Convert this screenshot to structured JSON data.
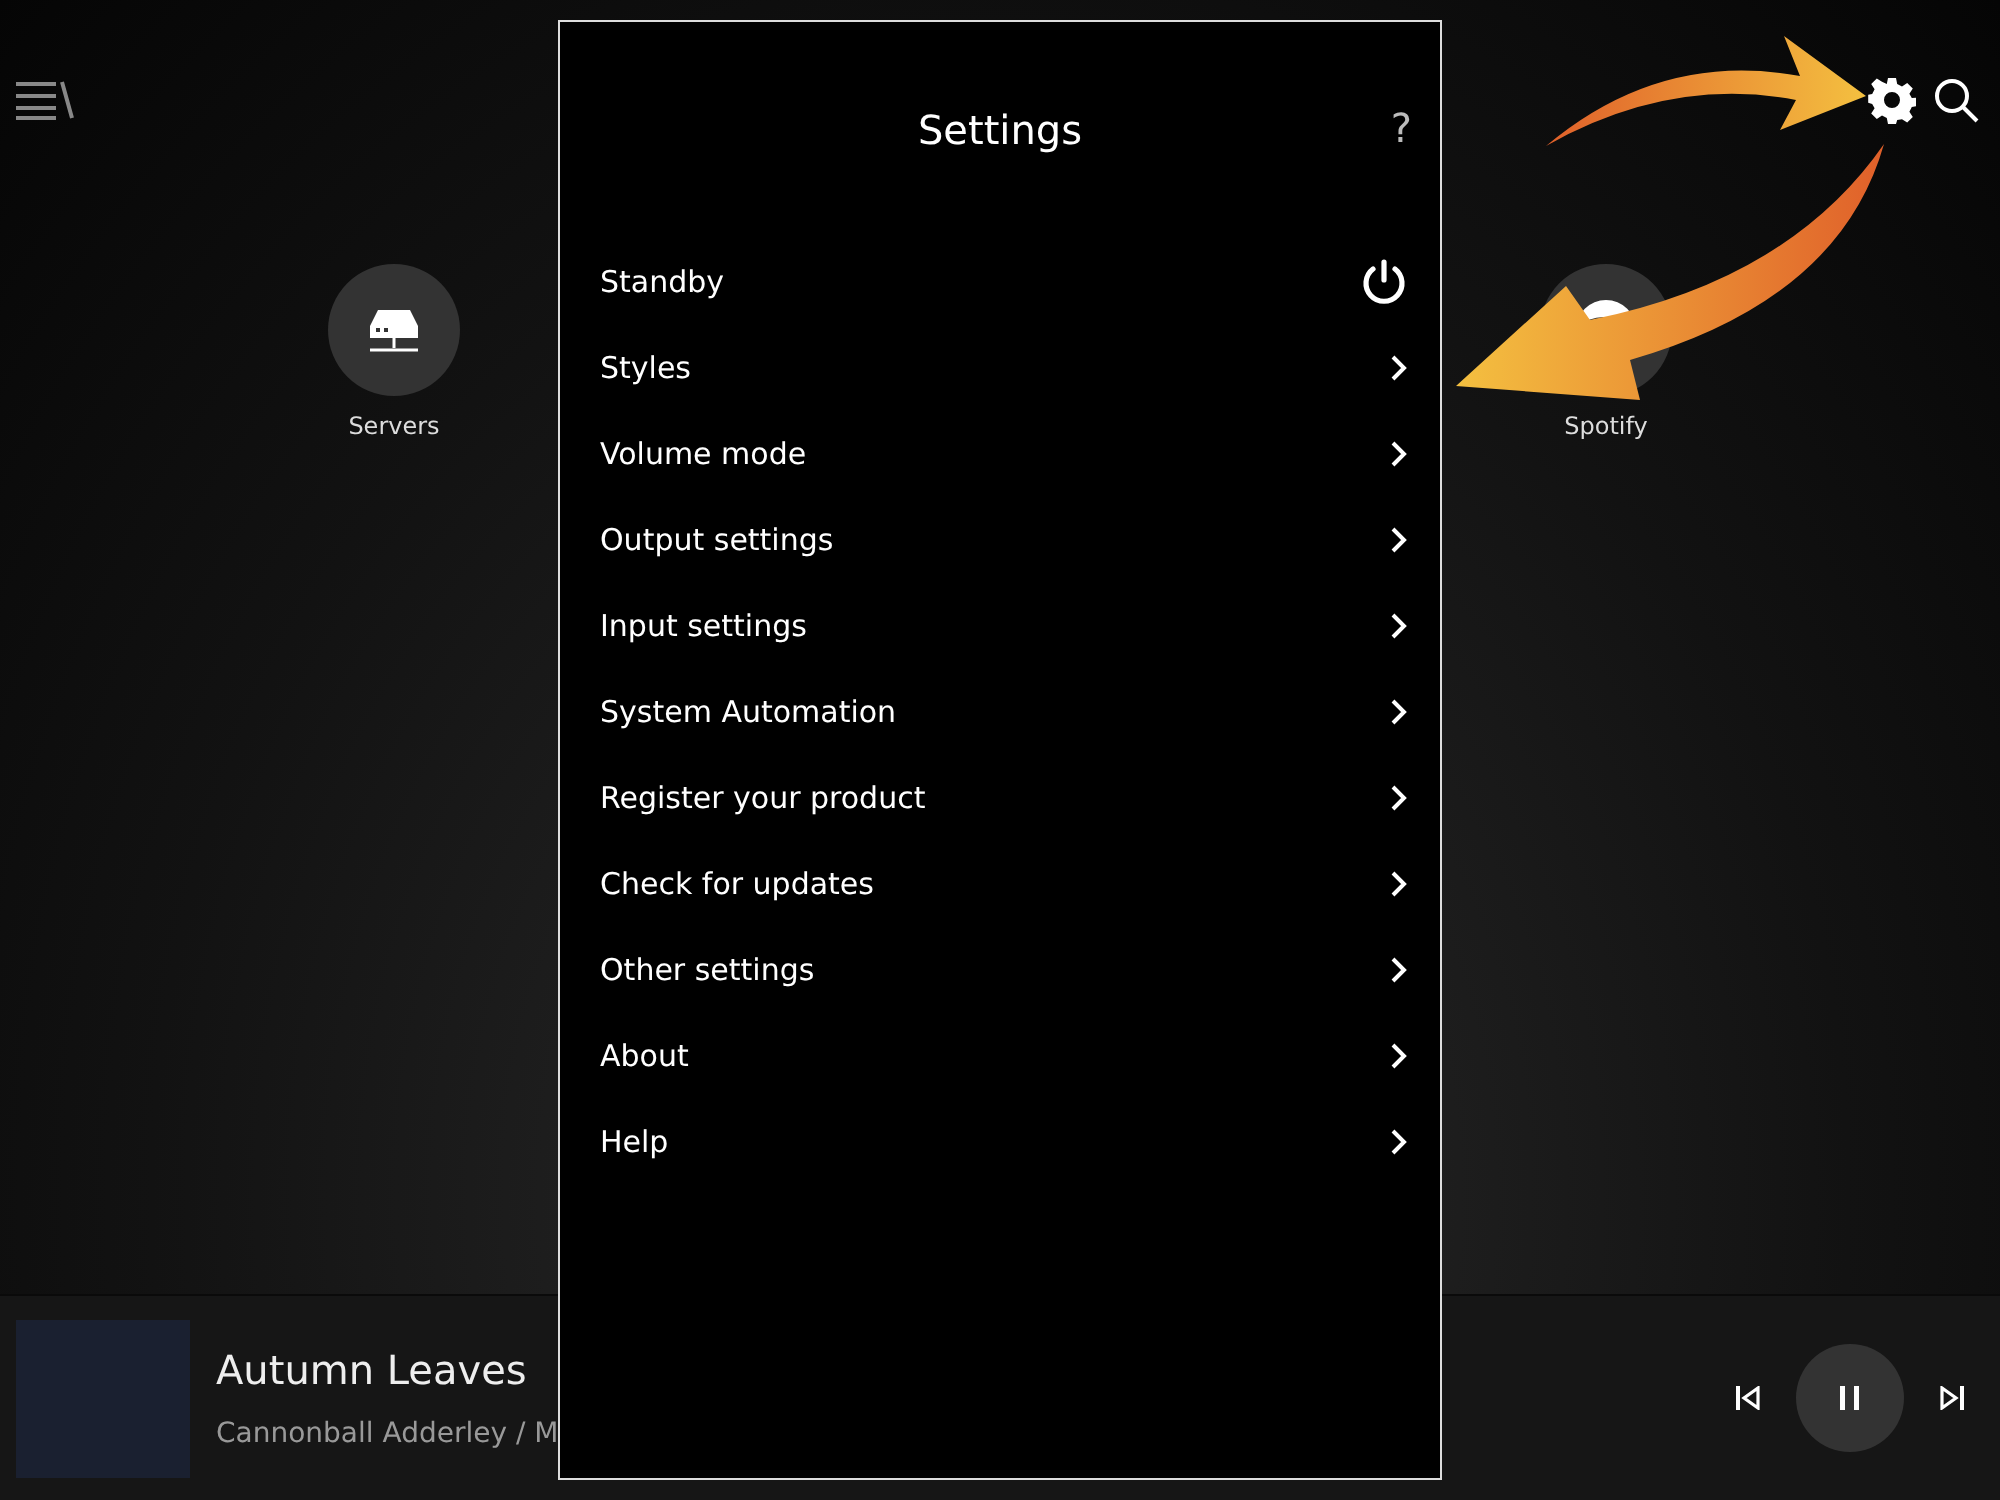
{
  "sources": [
    {
      "label": "Servers",
      "kind": "server"
    },
    {
      "label": "Spotify",
      "kind": "spotify"
    }
  ],
  "now_playing": {
    "title": "Autumn Leaves",
    "artist": "Cannonball Adderley / M"
  },
  "settings": {
    "title": "Settings",
    "help": "?",
    "items": [
      {
        "label": "Standby",
        "kind": "power"
      },
      {
        "label": "Styles",
        "kind": "link"
      },
      {
        "label": "Volume mode",
        "kind": "link"
      },
      {
        "label": "Output settings",
        "kind": "link"
      },
      {
        "label": "Input settings",
        "kind": "link"
      },
      {
        "label": "System Automation",
        "kind": "link"
      },
      {
        "label": "Register your product",
        "kind": "link"
      },
      {
        "label": "Check for updates",
        "kind": "link"
      },
      {
        "label": "Other settings",
        "kind": "link"
      },
      {
        "label": "About",
        "kind": "link"
      },
      {
        "label": "Help",
        "kind": "link"
      }
    ]
  }
}
